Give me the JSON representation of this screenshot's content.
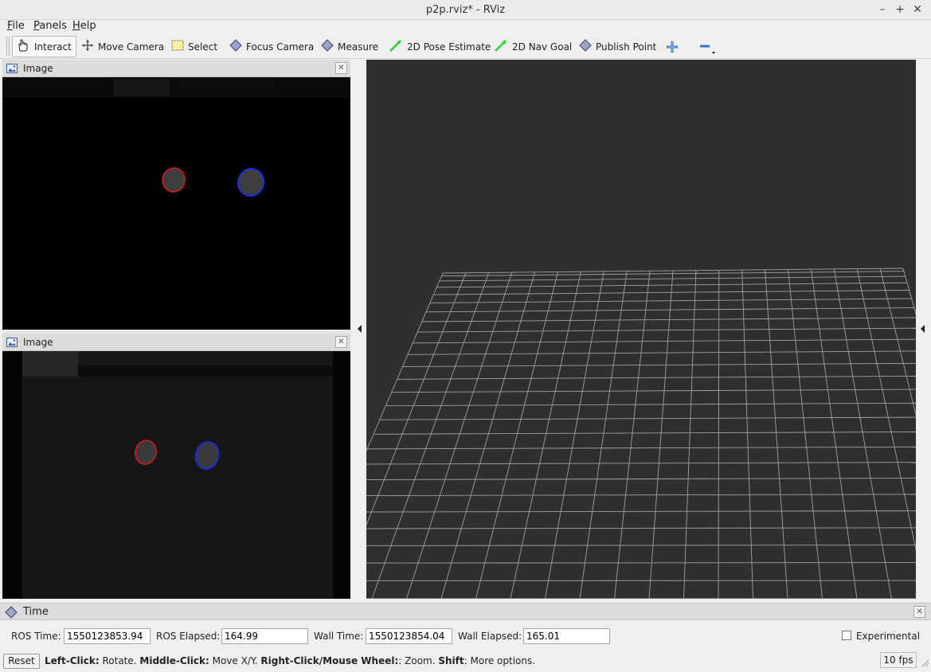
{
  "window": {
    "title": "p2p.rviz* - RViz"
  },
  "menu": {
    "items": [
      "File",
      "Panels",
      "Help"
    ]
  },
  "toolbar": {
    "tools": [
      {
        "label": "Interact",
        "icon": "hand-icon",
        "active": true
      },
      {
        "label": "Move Camera",
        "icon": "move-camera-icon"
      },
      {
        "label": "Select",
        "icon": "select-icon"
      },
      {
        "label": "Focus Camera",
        "icon": "focus-camera-icon"
      },
      {
        "label": "Measure",
        "icon": "measure-icon"
      },
      {
        "label": "2D Pose Estimate",
        "icon": "pose-estimate-icon"
      },
      {
        "label": "2D Nav Goal",
        "icon": "nav-goal-icon"
      },
      {
        "label": "Publish Point",
        "icon": "publish-point-icon"
      }
    ],
    "add_icon": "plus-icon",
    "remove_icon": "minus-icon"
  },
  "panels": {
    "image_top": {
      "title": "Image"
    },
    "image_bottom": {
      "title": "Image"
    }
  },
  "time": {
    "title": "Time",
    "ros_time_label": "ROS Time:",
    "ros_time": "1550123853.94",
    "ros_elapsed_label": "ROS Elapsed:",
    "ros_elapsed": "164.99",
    "wall_time_label": "Wall Time:",
    "wall_time": "1550123854.04",
    "wall_elapsed_label": "Wall Elapsed:",
    "wall_elapsed": "165.01",
    "experimental_label": "Experimental",
    "experimental_checked": false
  },
  "status": {
    "reset_label": "Reset",
    "hint_parts": [
      {
        "bold": "Left-Click:",
        "text": " Rotate. "
      },
      {
        "bold": "Middle-Click:",
        "text": " Move X/Y. "
      },
      {
        "bold": "Right-Click/Mouse Wheel:",
        "text": ": Zoom. "
      },
      {
        "bold": "Shift",
        "text": ": More options."
      }
    ],
    "fps": "10 fps"
  },
  "colors": {
    "viewport_bg": "#2f2f2f",
    "grid_line": "#a0a0a0",
    "red_marker": "#e01414",
    "blue_marker": "#1430e0",
    "nav_green": "#2ad82a"
  }
}
